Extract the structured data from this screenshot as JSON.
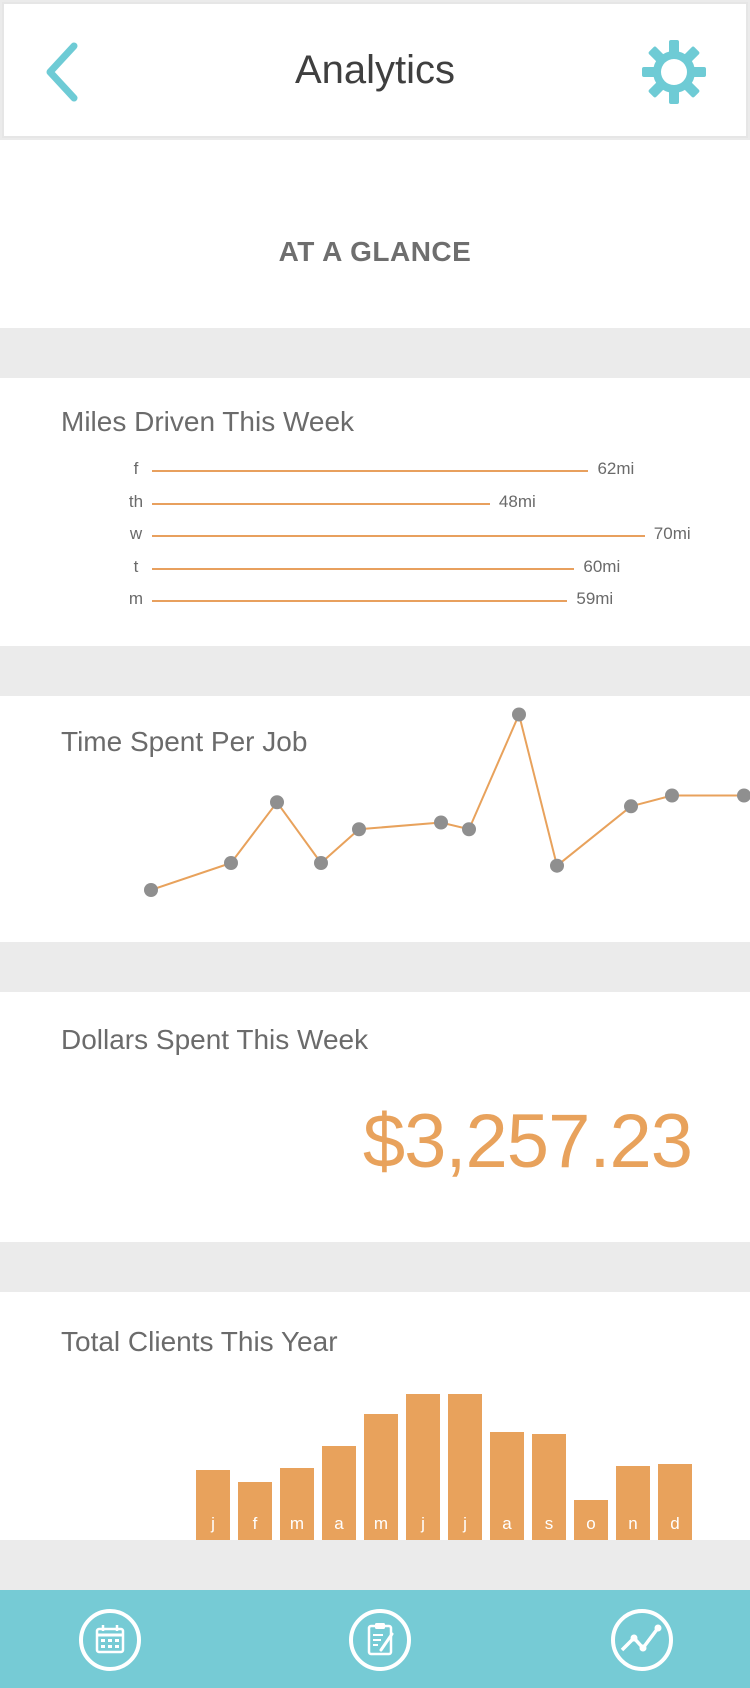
{
  "header": {
    "title": "Analytics",
    "back_icon": "chevron-left-icon",
    "settings_icon": "gear-icon"
  },
  "colors": {
    "accent": "#6ecbd5",
    "chart": "#e8a25c",
    "point": "#8f8f8f",
    "background": "#ebebeb",
    "nav_bar": "#76cbd5"
  },
  "glance": {
    "label": "AT A GLANCE"
  },
  "miles": {
    "title": "Miles Driven This Week",
    "rows": [
      {
        "day": "f",
        "value": 62,
        "label": "62mi"
      },
      {
        "day": "th",
        "value": 48,
        "label": "48mi"
      },
      {
        "day": "w",
        "value": 70,
        "label": "70mi"
      },
      {
        "day": "t",
        "value": 60,
        "label": "60mi"
      },
      {
        "day": "m",
        "value": 59,
        "label": "59mi"
      }
    ]
  },
  "time_per_job": {
    "title": "Time Spent Per Job"
  },
  "dollars": {
    "title": "Dollars Spent This Week",
    "amount": "$3,257.23"
  },
  "clients": {
    "title": "Total Clients This Year"
  },
  "chart_data": [
    {
      "type": "bar",
      "orientation": "horizontal",
      "title": "Miles Driven This Week",
      "categories": [
        "f",
        "th",
        "w",
        "t",
        "m"
      ],
      "values": [
        62,
        48,
        70,
        60,
        59
      ],
      "unit": "mi"
    },
    {
      "type": "line",
      "title": "Time Spent Per Job",
      "x": [
        1,
        2,
        3,
        4,
        5,
        6,
        7,
        8,
        9,
        10,
        11,
        12
      ],
      "values": [
        6,
        8,
        12.5,
        8,
        10.5,
        11,
        10.5,
        19,
        7.8,
        12.2,
        13,
        13
      ],
      "ylim": [
        0,
        20
      ]
    },
    {
      "type": "bar",
      "title": "Total Clients This Year",
      "categories": [
        "j",
        "f",
        "m",
        "a",
        "m",
        "j",
        "j",
        "a",
        "s",
        "o",
        "n",
        "d"
      ],
      "values": [
        70,
        58,
        72,
        94,
        126,
        146,
        146,
        108,
        106,
        40,
        74,
        76
      ],
      "ylim": [
        0,
        150
      ]
    }
  ],
  "bottom_nav": {
    "items": [
      {
        "name": "calendar",
        "icon": "calendar-icon"
      },
      {
        "name": "clipboard",
        "icon": "clipboard-icon"
      },
      {
        "name": "analytics",
        "icon": "chart-line-icon"
      }
    ]
  }
}
